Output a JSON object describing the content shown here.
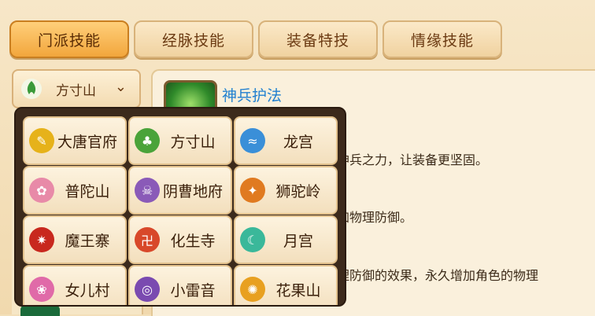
{
  "tabs": [
    {
      "label": "门派技能",
      "active": true
    },
    {
      "label": "经脉技能",
      "active": false
    },
    {
      "label": "装备特技",
      "active": false
    },
    {
      "label": "情缘技能",
      "active": false
    }
  ],
  "dropdown": {
    "selected": "方寸山",
    "icon": "fangcun-emblem-icon"
  },
  "skill": {
    "name": "神兵护法",
    "icon": "shenbing-skill-icon"
  },
  "description": {
    "line1": "神兵之力，让装备更坚固。",
    "line2": "加物理防御。",
    "line3": "理防御的效果，永久增加角色的物理"
  },
  "sects": [
    {
      "name": "大唐官府",
      "icon": "datang-icon",
      "color": "#e6b21a",
      "glyph": "✎"
    },
    {
      "name": "方寸山",
      "icon": "fangcun-icon",
      "color": "#4aa33a",
      "glyph": "♣"
    },
    {
      "name": "龙宫",
      "icon": "longgong-icon",
      "color": "#3a8fd8",
      "glyph": "≈"
    },
    {
      "name": "普陀山",
      "icon": "putuo-icon",
      "color": "#e88aa8",
      "glyph": "✿"
    },
    {
      "name": "阴曹地府",
      "icon": "yincao-icon",
      "color": "#8a5ab8",
      "glyph": "☠"
    },
    {
      "name": "狮驼岭",
      "icon": "shituo-icon",
      "color": "#e07a20",
      "glyph": "✦"
    },
    {
      "name": "魔王寨",
      "icon": "mowang-icon",
      "color": "#c8281e",
      "glyph": "✷"
    },
    {
      "name": "化生寺",
      "icon": "huasheng-icon",
      "color": "#d8482a",
      "glyph": "卍"
    },
    {
      "name": "月宫",
      "icon": "yuegong-icon",
      "color": "#3ab89a",
      "glyph": "☾"
    },
    {
      "name": "女儿村",
      "icon": "nver-icon",
      "color": "#e06aa8",
      "glyph": "❀"
    },
    {
      "name": "小雷音",
      "icon": "xiaoleiyin-icon",
      "color": "#7a4ab0",
      "glyph": "◎"
    },
    {
      "name": "花果山",
      "icon": "huaguo-icon",
      "color": "#e8a020",
      "glyph": "✺"
    }
  ]
}
